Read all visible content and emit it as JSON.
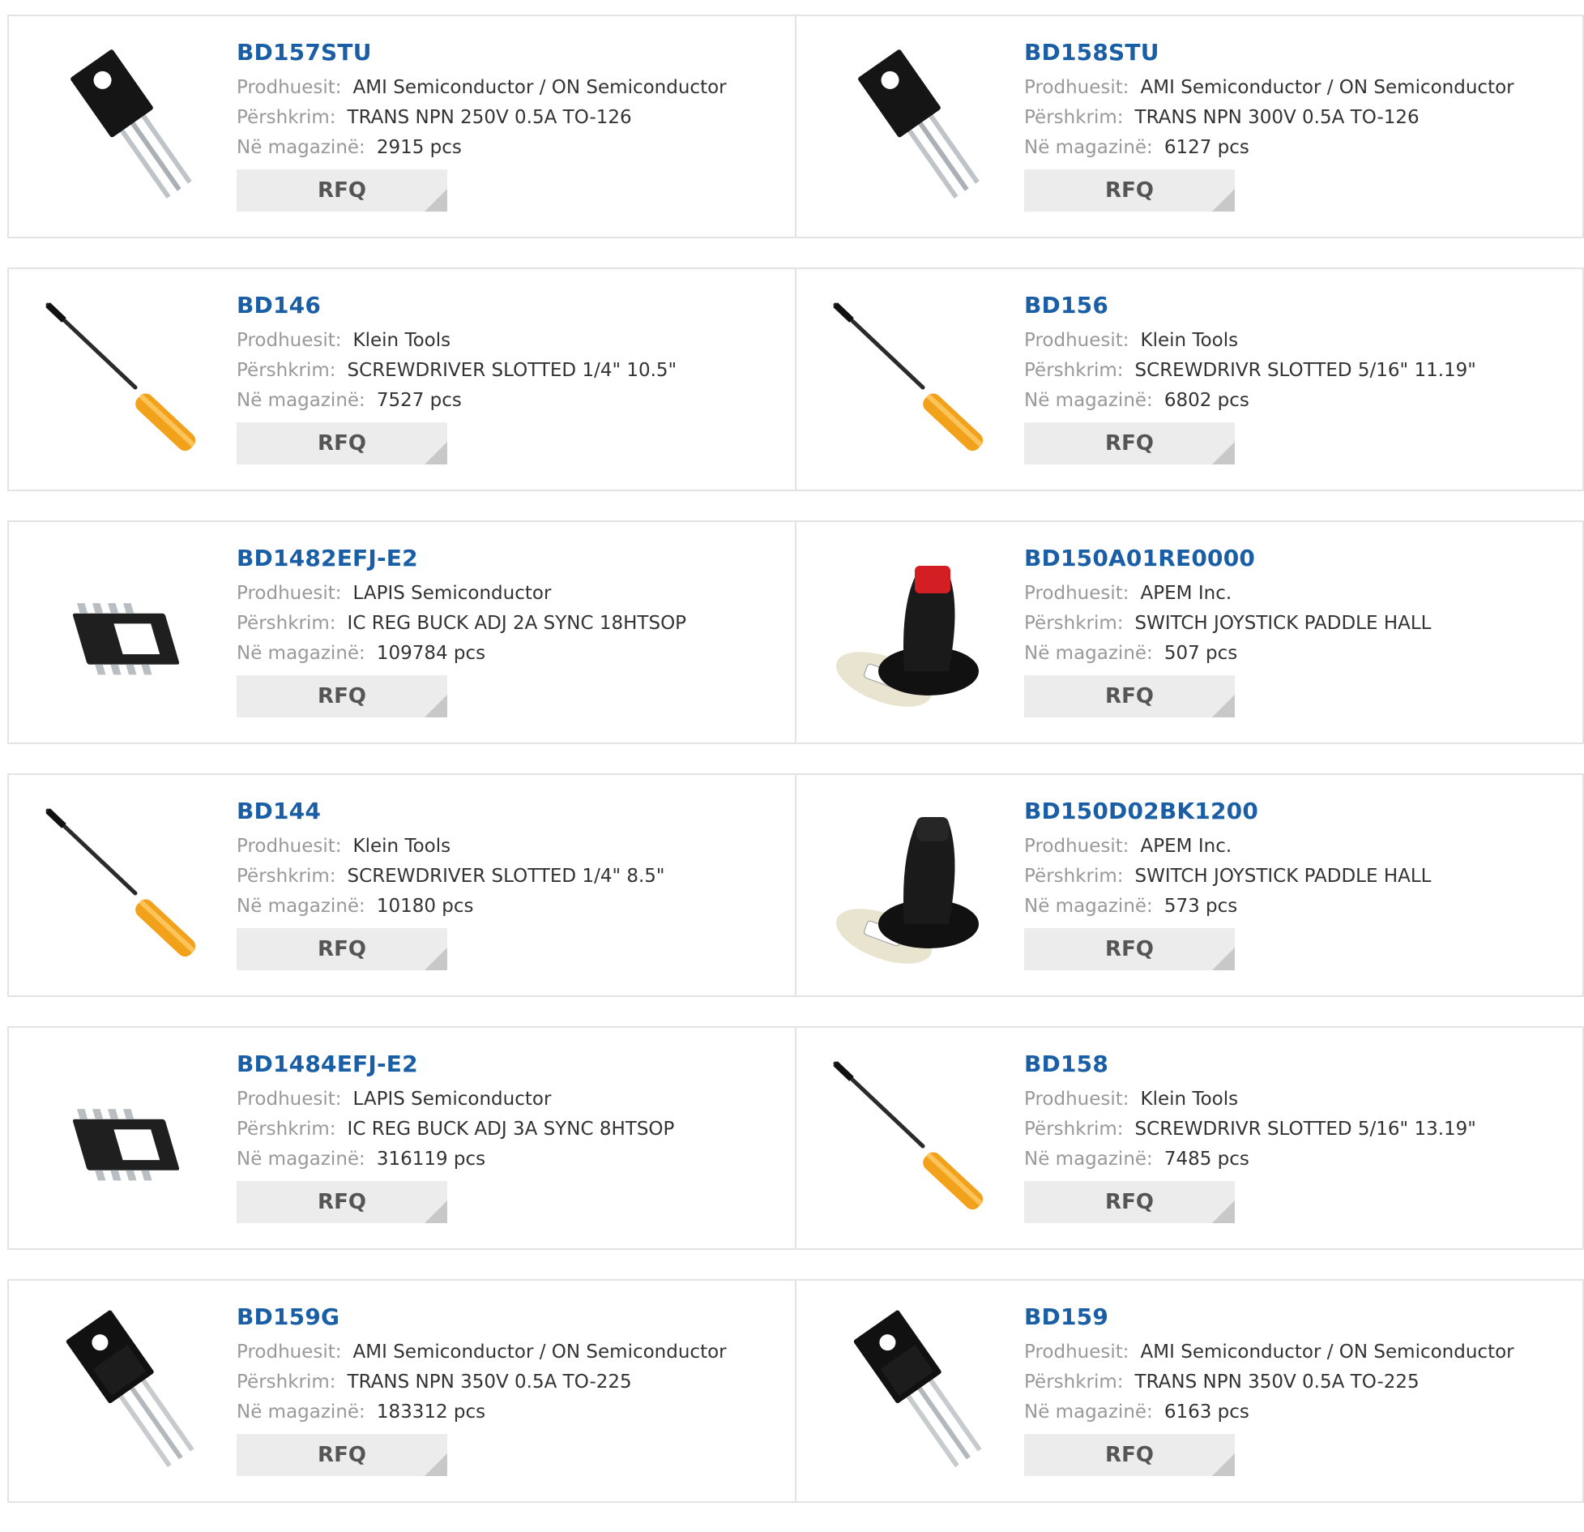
{
  "labels": {
    "manufacturer": "Prodhuesit:",
    "description": "Përshkrim:",
    "stock": "Në magazinë:",
    "rfq": "RFQ"
  },
  "products": [
    {
      "part": "BD157STU",
      "manufacturer": "AMI Semiconductor / ON Semiconductor",
      "description": "TRANS NPN 250V 0.5A TO-126",
      "stock": "2915 pcs",
      "image": "transistor-to126-icon"
    },
    {
      "part": "BD158STU",
      "manufacturer": "AMI Semiconductor / ON Semiconductor",
      "description": "TRANS NPN 300V 0.5A TO-126",
      "stock": "6127 pcs",
      "image": "transistor-to126-icon"
    },
    {
      "part": "BD146",
      "manufacturer": "Klein Tools",
      "description": "SCREWDRIVER SLOTTED 1/4\" 10.5\"",
      "stock": "7527 pcs",
      "image": "screwdriver-icon"
    },
    {
      "part": "BD156",
      "manufacturer": "Klein Tools",
      "description": "SCREWDRIVR SLOTTED 5/16\" 11.19\"",
      "stock": "6802 pcs",
      "image": "screwdriver-icon"
    },
    {
      "part": "BD1482EFJ-E2",
      "manufacturer": "LAPIS Semiconductor",
      "description": "IC REG BUCK ADJ 2A SYNC 18HTSOP",
      "stock": "109784 pcs",
      "image": "ic-chip-icon"
    },
    {
      "part": "BD150A01RE0000",
      "manufacturer": "APEM Inc.",
      "description": "SWITCH JOYSTICK PADDLE HALL",
      "stock": "507 pcs",
      "image": "joystick-red-icon"
    },
    {
      "part": "BD144",
      "manufacturer": "Klein Tools",
      "description": "SCREWDRIVER SLOTTED 1/4\" 8.5\"",
      "stock": "10180 pcs",
      "image": "screwdriver-icon"
    },
    {
      "part": "BD150D02BK1200",
      "manufacturer": "APEM Inc.",
      "description": "SWITCH JOYSTICK PADDLE HALL",
      "stock": "573 pcs",
      "image": "joystick-black-icon"
    },
    {
      "part": "BD1484EFJ-E2",
      "manufacturer": "LAPIS Semiconductor",
      "description": "IC REG BUCK ADJ 3A SYNC 8HTSOP",
      "stock": "316119 pcs",
      "image": "ic-chip-icon"
    },
    {
      "part": "BD158",
      "manufacturer": "Klein Tools",
      "description": "SCREWDRIVR SLOTTED 5/16\" 13.19\"",
      "stock": "7485 pcs",
      "image": "screwdriver-icon"
    },
    {
      "part": "BD159G",
      "manufacturer": "AMI Semiconductor / ON Semiconductor",
      "description": "TRANS NPN 350V 0.5A TO-225",
      "stock": "183312 pcs",
      "image": "transistor-to225-icon"
    },
    {
      "part": "BD159",
      "manufacturer": "AMI Semiconductor / ON Semiconductor",
      "description": "TRANS NPN 350V 0.5A TO-225",
      "stock": "6163 pcs",
      "image": "transistor-to225-icon"
    }
  ]
}
